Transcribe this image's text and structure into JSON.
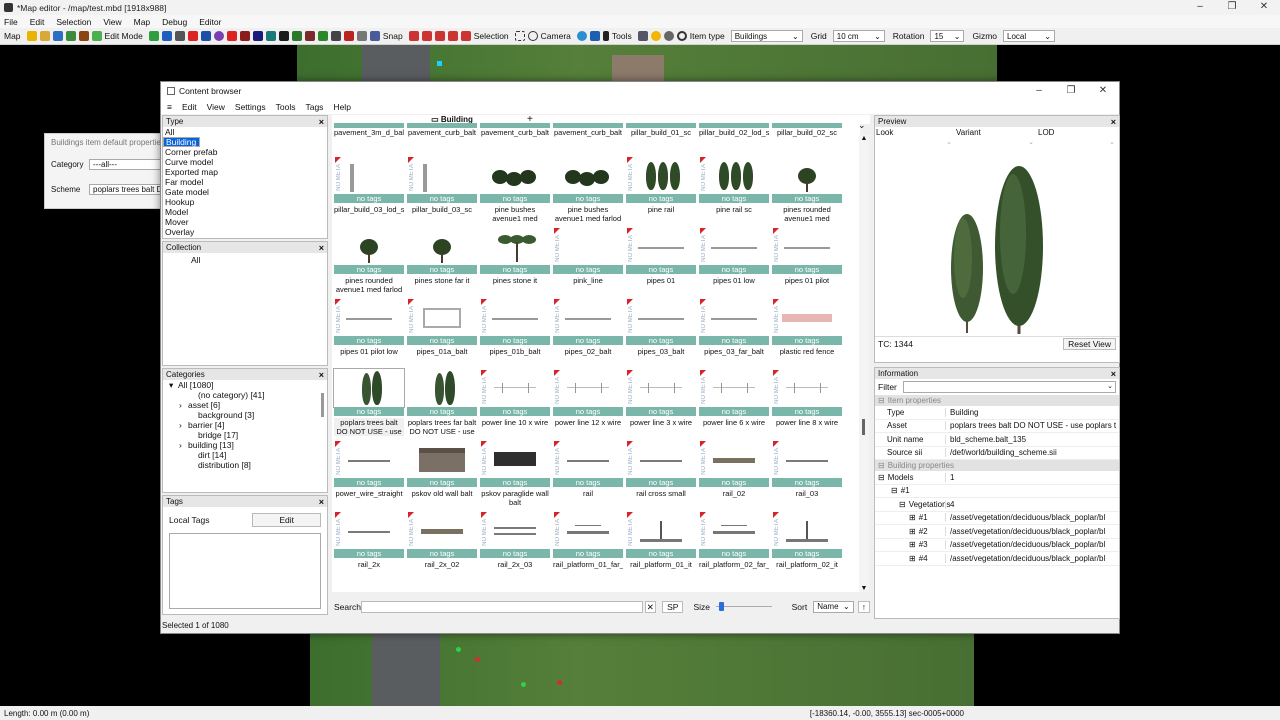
{
  "window": {
    "title": "*Map editor - /map/test.mbd [1918x988]",
    "controls": [
      "–",
      "❐",
      "✕"
    ]
  },
  "menubar": [
    "File",
    "Edit",
    "Selection",
    "View",
    "Map",
    "Debug",
    "Editor"
  ],
  "toolbar": {
    "map": "Map",
    "edit_mode": "Edit Mode",
    "snap": "Snap",
    "selection": "Selection",
    "camera": "Camera",
    "tools": "Tools",
    "item_type_label": "Item type",
    "item_type_value": "Buildings",
    "grid_label": "Grid",
    "grid_value": "10 cm",
    "rotation_label": "Rotation",
    "rotation_value": "15",
    "gizmo_label": "Gizmo",
    "gizmo_value": "Local"
  },
  "ghost_dialog": {
    "title": "Buildings item default properties",
    "category_label": "Category",
    "category_value": "---all---",
    "scheme_label": "Scheme",
    "scheme_value": "poplars trees balt DO"
  },
  "content_browser": {
    "title": "Content browser",
    "menu": [
      "≡",
      "Edit",
      "View",
      "Settings",
      "Tools",
      "Tags",
      "Help"
    ],
    "type_panel": {
      "title": "Type",
      "items": [
        "All",
        "Building",
        "Corner prefab",
        "Curve model",
        "Exported map",
        "Far model",
        "Gate model",
        "Hookup",
        "Model",
        "Mover",
        "Overlay"
      ],
      "selected": 1
    },
    "collection_panel": {
      "title": "Collection",
      "items": [
        "All"
      ]
    },
    "categories_panel": {
      "title": "Categories",
      "items": [
        {
          "label": "All [1080]",
          "indent": 0,
          "exp": "▾"
        },
        {
          "label": "(no category) [41]",
          "indent": 2,
          "exp": ""
        },
        {
          "label": "asset [6]",
          "indent": 1,
          "exp": "›"
        },
        {
          "label": "background [3]",
          "indent": 2,
          "exp": ""
        },
        {
          "label": "barrier [4]",
          "indent": 1,
          "exp": "›"
        },
        {
          "label": "bridge [17]",
          "indent": 2,
          "exp": ""
        },
        {
          "label": "building [13]",
          "indent": 1,
          "exp": "›"
        },
        {
          "label": "dirt [14]",
          "indent": 2,
          "exp": ""
        },
        {
          "label": "distribution [8]",
          "indent": 2,
          "exp": ""
        }
      ]
    },
    "tags_panel": {
      "title": "Tags",
      "local_tags": "Local Tags",
      "edit": "Edit"
    },
    "tab": {
      "label": "Building",
      "add": "+"
    },
    "top_row_labels": [
      "pavement_3m_d_bal",
      "pavement_curb_balt",
      "pavement_curb_balt",
      "pavement_curb_balt",
      "pillar_build_01_sc",
      "pillar_build_02_lod_s",
      "pillar_build_02_sc"
    ],
    "top_row_tag": "no tags",
    "tiles": [
      {
        "label": "pillar_build_03_lod_s",
        "thumb": "pillar",
        "meta": true
      },
      {
        "label": "pillar_build_03_sc",
        "thumb": "pillar",
        "meta": true
      },
      {
        "label": "pine bushes avenue1 med",
        "thumb": "bushes",
        "meta": false
      },
      {
        "label": "pine bushes avenue1 med farlod",
        "thumb": "bushes",
        "meta": false
      },
      {
        "label": "pine rail",
        "thumb": "pines",
        "meta": true
      },
      {
        "label": "pine rail sc",
        "thumb": "pines",
        "meta": true
      },
      {
        "label": "pines rounded avenue1 med",
        "thumb": "round",
        "meta": false
      },
      {
        "label": "pines rounded avenue1 med farlod",
        "thumb": "round",
        "meta": false
      },
      {
        "label": "pines stone far it",
        "thumb": "round",
        "meta": false
      },
      {
        "label": "pines stone it",
        "thumb": "stone",
        "meta": false
      },
      {
        "label": "pink_line",
        "thumb": "none",
        "meta": true
      },
      {
        "label": "pipes 01",
        "thumb": "pipe",
        "meta": true
      },
      {
        "label": "pipes 01 low",
        "thumb": "pipe",
        "meta": true
      },
      {
        "label": "pipes 01 pilot",
        "thumb": "pipe",
        "meta": true
      },
      {
        "label": "pipes 01 pilot low",
        "thumb": "pipe",
        "meta": true
      },
      {
        "label": "pipes_01a_balt",
        "thumb": "frame",
        "meta": true
      },
      {
        "label": "pipes_01b_balt",
        "thumb": "pipe",
        "meta": true
      },
      {
        "label": "pipes_02_balt",
        "thumb": "pipe",
        "meta": true
      },
      {
        "label": "pipes_03_balt",
        "thumb": "pipe",
        "meta": true
      },
      {
        "label": "pipes_03_far_balt",
        "thumb": "pipe",
        "meta": true
      },
      {
        "label": "plastic red fence",
        "thumb": "fence",
        "meta": true
      },
      {
        "label": "poplars trees balt DO NOT USE - use",
        "thumb": "poplar",
        "meta": false,
        "selected": true
      },
      {
        "label": "poplars trees far balt DO NOT USE - use",
        "thumb": "poplar",
        "meta": false
      },
      {
        "label": "power line 10 x wire",
        "thumb": "wire",
        "meta": true
      },
      {
        "label": "power line 12 x wire",
        "thumb": "wire",
        "meta": true
      },
      {
        "label": "power line 3 x wire",
        "thumb": "wire",
        "meta": true
      },
      {
        "label": "power line 6 x wire",
        "thumb": "wire",
        "meta": true
      },
      {
        "label": "power line 8 x wire",
        "thumb": "wire",
        "meta": true
      },
      {
        "label": "power_wire_straight",
        "thumb": "line",
        "meta": true
      },
      {
        "label": "pskov old wall balt",
        "thumb": "wall",
        "meta": false
      },
      {
        "label": "pskov paraglide wall balt",
        "thumb": "dark",
        "meta": true
      },
      {
        "label": "rail",
        "thumb": "line",
        "meta": true
      },
      {
        "label": "rail cross small",
        "thumb": "line",
        "meta": true
      },
      {
        "label": "rail_02",
        "thumb": "thick",
        "meta": true
      },
      {
        "label": "rail_03",
        "thumb": "line",
        "meta": true
      },
      {
        "label": "rail_2x",
        "thumb": "line",
        "meta": true
      },
      {
        "label": "rail_2x_02",
        "thumb": "thick",
        "meta": true
      },
      {
        "label": "rail_2x_03",
        "thumb": "line2",
        "meta": true
      },
      {
        "label": "rail_platform_01_far_",
        "thumb": "platform",
        "meta": true
      },
      {
        "label": "rail_platform_01_it",
        "thumb": "lamp",
        "meta": true
      },
      {
        "label": "rail_platform_02_far_",
        "thumb": "platform",
        "meta": true
      },
      {
        "label": "rail_platform_02_it",
        "thumb": "lamp",
        "meta": true
      }
    ],
    "tag_text": "no tags",
    "meta_text": "NO META",
    "search": {
      "label": "Search",
      "sp": "SP",
      "size_label": "Size",
      "size_level": 0.05,
      "sort_label": "Sort",
      "sort_value": "Name",
      "sort_dir": "↑"
    },
    "preview": {
      "title": "Preview",
      "cols": [
        "Look",
        "Variant",
        "LOD"
      ],
      "tc": "TC: 1344",
      "reset": "Reset View"
    },
    "information": {
      "title": "Information",
      "filter_label": "Filter",
      "sec_item": "Item properties",
      "rows_item": [
        {
          "k": "Type",
          "v": "Building"
        },
        {
          "k": "Asset",
          "v": "poplars trees balt DO NOT USE - use poplars t"
        },
        {
          "k": "Unit name",
          "v": "bld_scheme.balt_135"
        },
        {
          "k": "Source sii",
          "v": "/def/world/building_scheme.sii"
        }
      ],
      "sec_building": "Building properties",
      "models": {
        "k": "Models",
        "v": "1"
      },
      "model1": "#1",
      "vegetations": {
        "k": "Vegetations",
        "v": "4"
      },
      "veg_rows": [
        {
          "k": "#1",
          "v": "/asset/vegetation/deciduous/black_poplar/bl"
        },
        {
          "k": "#2",
          "v": "/asset/vegetation/deciduous/black_poplar/bl"
        },
        {
          "k": "#3",
          "v": "/asset/vegetation/deciduous/black_poplar/bl"
        },
        {
          "k": "#4",
          "v": "/asset/vegetation/deciduous/black_poplar/bl"
        }
      ]
    },
    "status": "Selected 1 of 1080"
  },
  "statusbar": {
    "left": "Length: 0.00 m (0.00 m)",
    "right": "[-18360.14, -0.00, 3555.13] sec-0005+0000"
  }
}
